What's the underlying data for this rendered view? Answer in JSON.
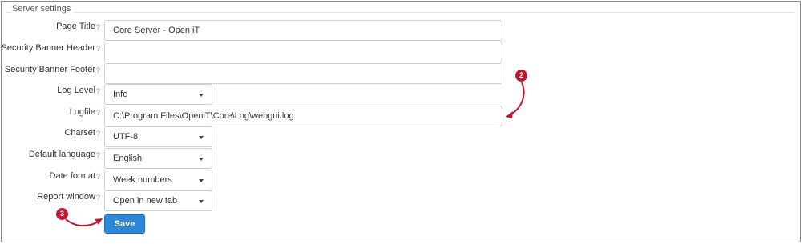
{
  "section_title": "Server settings",
  "help_glyph": "?",
  "fields": {
    "page_title": {
      "label": "Page Title",
      "value": "Core Server - Open iT"
    },
    "banner_header": {
      "label": "Security Banner Header",
      "value": ""
    },
    "banner_footer": {
      "label": "Security Banner Footer",
      "value": ""
    },
    "log_level": {
      "label": "Log Level",
      "value": "Info"
    },
    "logfile": {
      "label": "Logfile",
      "value": "C:\\Program Files\\OpeniT\\Core\\Log\\webgui.log"
    },
    "charset": {
      "label": "Charset",
      "value": "UTF-8"
    },
    "default_language": {
      "label": "Default language",
      "value": "English"
    },
    "date_format": {
      "label": "Date format",
      "value": "Week numbers"
    },
    "report_window": {
      "label": "Report window",
      "value": "Open in new tab"
    }
  },
  "save_label": "Save",
  "annotations": {
    "callout_2": "2",
    "callout_3": "3"
  },
  "colors": {
    "accent": "#2e86d8",
    "callout": "#c0182f",
    "help": "#6fa86f"
  }
}
